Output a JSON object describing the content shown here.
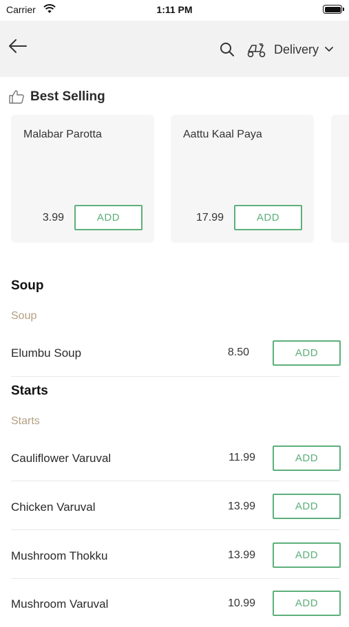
{
  "status_bar": {
    "carrier": "Carrier",
    "time": "1:11 PM"
  },
  "nav": {
    "delivery_label": "Delivery"
  },
  "best_selling": {
    "title": "Best Selling",
    "items": [
      {
        "name": "Malabar Parotta",
        "price": "3.99",
        "button": "ADD"
      },
      {
        "name": "Aattu Kaal Paya",
        "price": "17.99",
        "button": "ADD"
      }
    ]
  },
  "sections": [
    {
      "title": "Soup",
      "subtitle": "Soup",
      "items": [
        {
          "name": "Elumbu Soup",
          "price": "8.50",
          "button": "ADD"
        }
      ]
    },
    {
      "title": "Starts",
      "subtitle": "Starts",
      "items": [
        {
          "name": "Cauliflower Varuval",
          "price": "11.99",
          "button": "ADD"
        },
        {
          "name": "Chicken Varuval",
          "price": "13.99",
          "button": "ADD"
        },
        {
          "name": "Mushroom Thokku",
          "price": "13.99",
          "button": "ADD"
        },
        {
          "name": "Mushroom Varuval",
          "price": "10.99",
          "button": "ADD"
        }
      ]
    }
  ],
  "colors": {
    "accent": "#5caf7a",
    "subtitle": "#b39f80",
    "navbar": "#f2f2f2"
  }
}
